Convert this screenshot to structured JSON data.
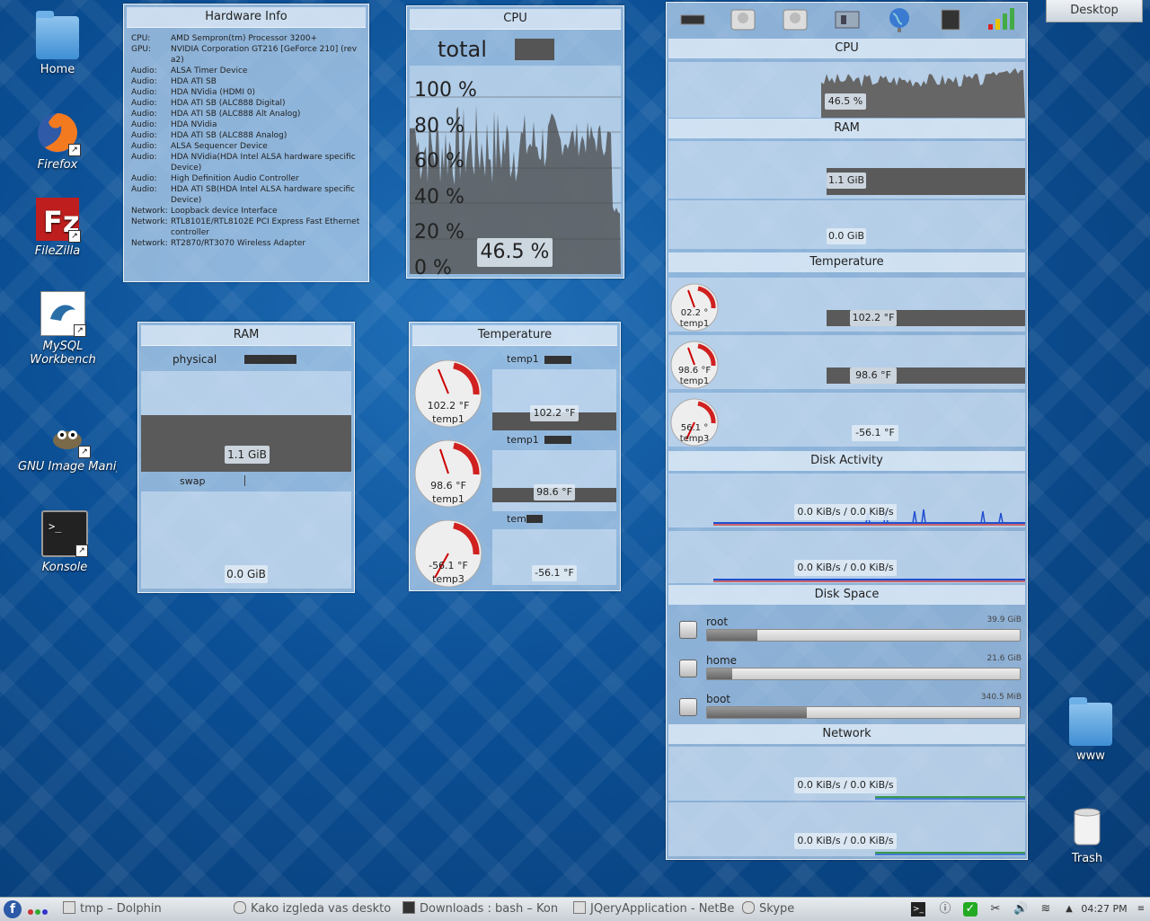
{
  "desktop": {
    "icons": [
      {
        "label": "Home"
      },
      {
        "label": "Firefox"
      },
      {
        "label": "FileZilla"
      },
      {
        "label": "MySQL Workbench"
      },
      {
        "label": "GNU Image Manipulation P"
      },
      {
        "label": "Konsole"
      },
      {
        "label": "www"
      },
      {
        "label": "Trash"
      }
    ],
    "toolbox_label": "Desktop"
  },
  "hardware": {
    "title": "Hardware Info",
    "rows": [
      {
        "k": "CPU:",
        "v": "AMD Sempron(tm) Processor 3200+"
      },
      {
        "k": "GPU:",
        "v": "NVIDIA Corporation GT216 [GeForce 210] (rev a2)"
      },
      {
        "k": "Audio:",
        "v": "ALSA Timer Device"
      },
      {
        "k": "Audio:",
        "v": "HDA ATI SB"
      },
      {
        "k": "Audio:",
        "v": "HDA NVidia (HDMI 0)"
      },
      {
        "k": "Audio:",
        "v": "HDA ATI SB (ALC888 Digital)"
      },
      {
        "k": "Audio:",
        "v": "HDA ATI SB (ALC888 Alt Analog)"
      },
      {
        "k": "Audio:",
        "v": "HDA NVidia"
      },
      {
        "k": "Audio:",
        "v": "HDA ATI SB (ALC888 Analog)"
      },
      {
        "k": "Audio:",
        "v": "ALSA Sequencer Device"
      },
      {
        "k": "Audio:",
        "v": "HDA NVidia(HDA Intel ALSA hardware specific Device)"
      },
      {
        "k": "Audio:",
        "v": "High Definition Audio Controller"
      },
      {
        "k": "Audio:",
        "v": "HDA ATI SB(HDA Intel ALSA hardware specific Device)"
      },
      {
        "k": "Network:",
        "v": "Loopback device Interface"
      },
      {
        "k": "Network:",
        "v": "RTL8101E/RTL8102E PCI Express Fast Ethernet controller"
      },
      {
        "k": "Network:",
        "v": "RT2870/RT3070 Wireless Adapter"
      }
    ]
  },
  "cpu_widget": {
    "title": "CPU",
    "legend": "total",
    "ticks": [
      "100 %",
      "80 %",
      "60 %",
      "40 %",
      "20 %",
      "0 %"
    ],
    "value": "46.5 %"
  },
  "ram_widget": {
    "title": "RAM",
    "physical_label": "physical",
    "physical_value": "1.1 GiB",
    "swap_label": "swap",
    "swap_value": "0.0 GiB"
  },
  "temp_widget": {
    "title": "Temperature",
    "gauges": [
      {
        "value": "102.2 °F",
        "name": "temp1"
      },
      {
        "value": "98.6 °F",
        "name": "temp1"
      },
      {
        "value": "-56.1 °F",
        "name": "temp3"
      }
    ],
    "plots": [
      {
        "label": "temp1",
        "value": "102.2 °F"
      },
      {
        "label": "temp1",
        "value": "98.6 °F"
      },
      {
        "label": "tem",
        "value": "-56.1 °F"
      }
    ]
  },
  "monitor": {
    "cpu_title": "CPU",
    "cpu_value": "46.5 %",
    "ram_title": "RAM",
    "ram_physical": "1.1 GiB",
    "ram_swap": "0.0 GiB",
    "temp_title": "Temperature",
    "temps": [
      {
        "gauge": "02.2 °",
        "name": "temp1",
        "value": "102.2 °F"
      },
      {
        "gauge": "98.6 °F",
        "name": "temp1",
        "value": "98.6 °F"
      },
      {
        "gauge": "56.1 °",
        "name": "temp3",
        "value": "-56.1 °F"
      }
    ],
    "disk_activity_title": "Disk Activity",
    "disk_activity": [
      "0.0 KiB/s / 0.0 KiB/s",
      "0.0 KiB/s / 0.0 KiB/s"
    ],
    "disk_space_title": "Disk Space",
    "disks": [
      {
        "name": "root",
        "size": "39.9 GiB",
        "used": 0.16
      },
      {
        "name": "home",
        "size": "21.6 GiB",
        "used": 0.08
      },
      {
        "name": "boot",
        "size": "340.5 MiB",
        "used": 0.32
      }
    ],
    "network_title": "Network",
    "network": [
      "0.0 KiB/s / 0.0 KiB/s",
      "0.0 KiB/s / 0.0 KiB/s"
    ]
  },
  "taskbar": {
    "tasks": [
      {
        "label": "tmp – Dolphin"
      },
      {
        "label": "Kako izgleda vas deskto"
      },
      {
        "label": "Downloads : bash – Kon"
      },
      {
        "label": "JQeryApplication - NetBe"
      },
      {
        "label": "Skype"
      }
    ],
    "clock": "04:27 PM"
  }
}
